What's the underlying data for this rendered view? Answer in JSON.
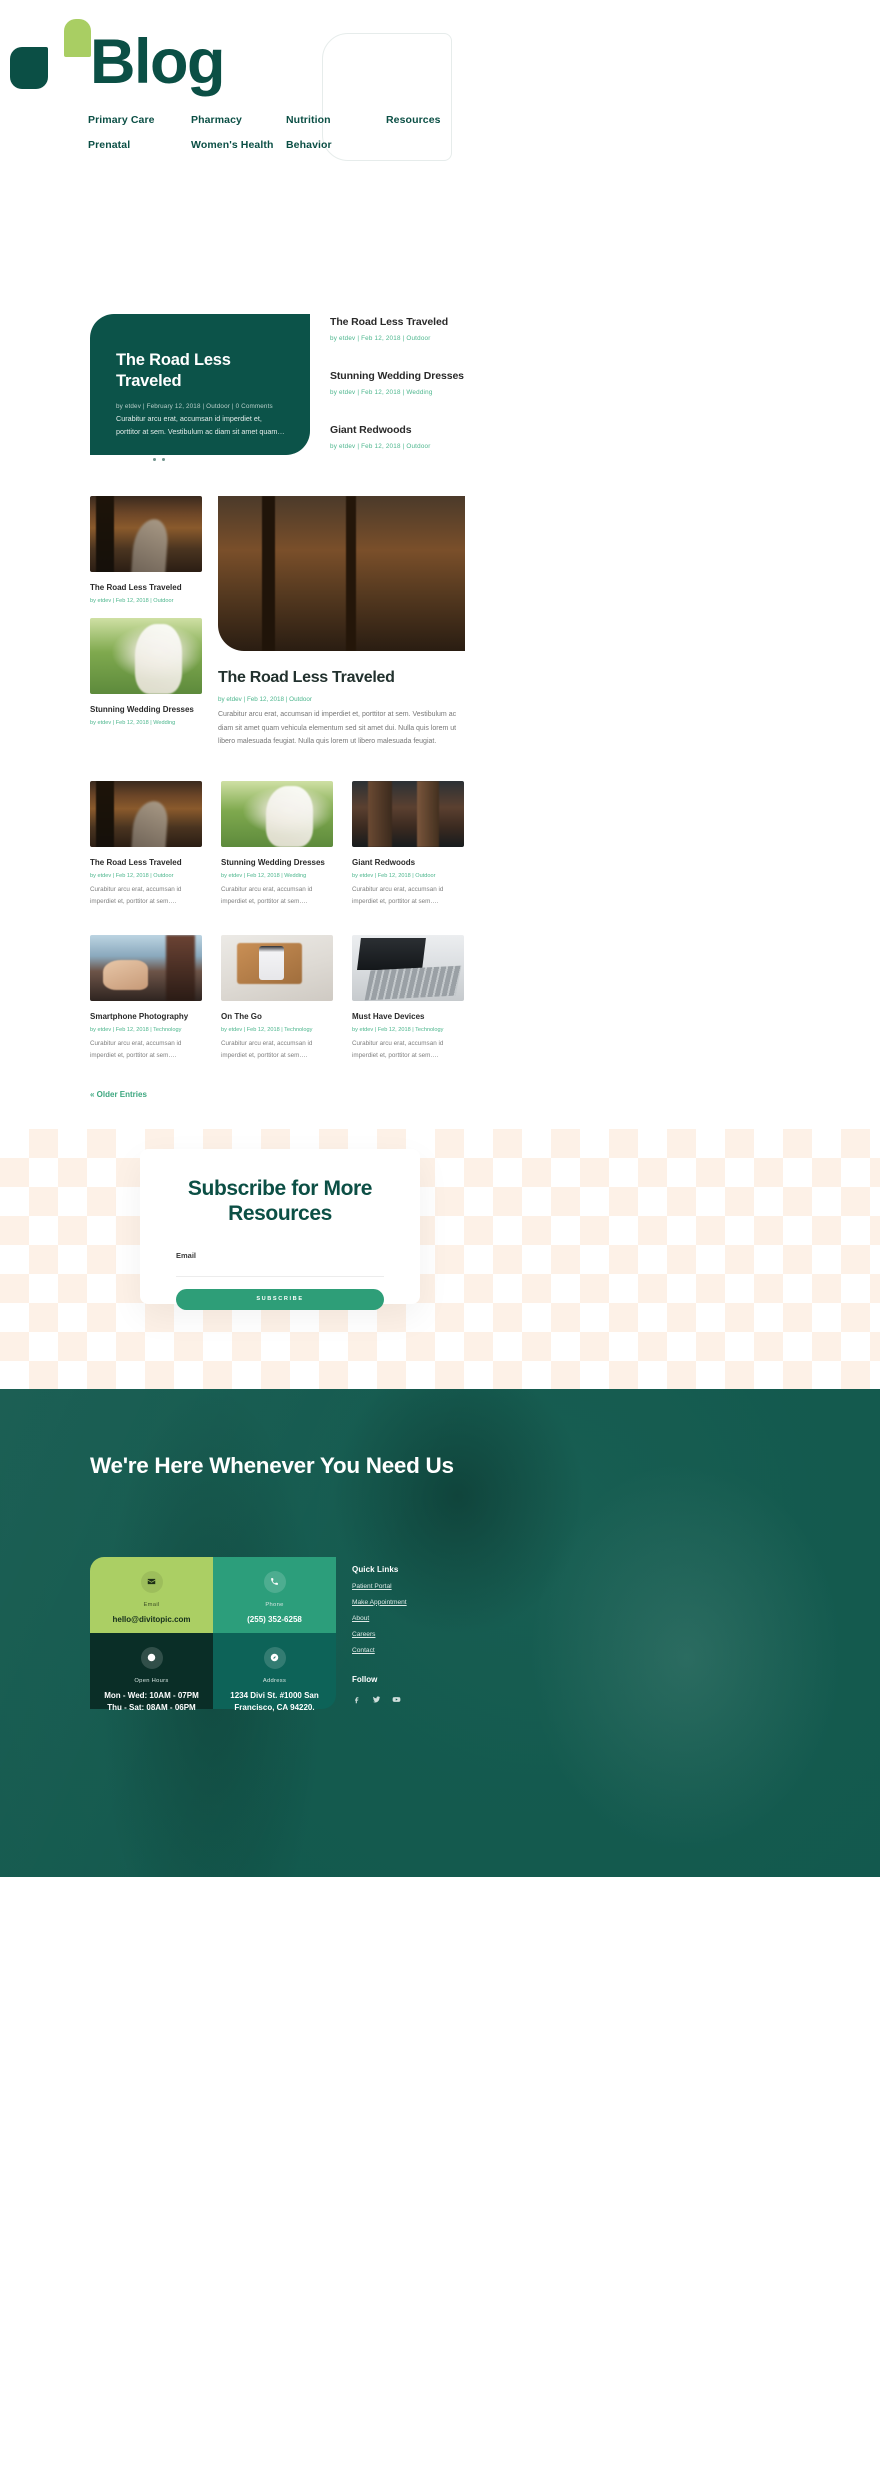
{
  "brand": {
    "title": "Blog",
    "logo_icon": "leaf-logo-icon"
  },
  "nav": {
    "panel_label": "Resources",
    "row1": [
      "Primary Care",
      "Pharmacy",
      "Nutrition"
    ],
    "row2": [
      "Prenatal",
      "Women's Health",
      "Behavior"
    ]
  },
  "featured": {
    "title": "The Road Less Traveled",
    "meta": "by etdev | February 12, 2018 | Outdoor | 0 Comments",
    "excerpt": "Curabitur arcu erat, accumsan id imperdiet et, porttitor at sem. Vestibulum ac diam sit amet quam…",
    "slides": 3,
    "active_slide": 1
  },
  "side_posts": [
    {
      "title": "The Road Less Traveled",
      "meta": "by etdev | Feb 12, 2018 | Outdoor"
    },
    {
      "title": "Stunning Wedding Dresses",
      "meta": "by etdev | Feb 12, 2018 | Wedding"
    },
    {
      "title": "Giant Redwoods",
      "meta": "by etdev | Feb 12, 2018 | Outdoor"
    }
  ],
  "left_posts": [
    {
      "title": "The Road Less Traveled",
      "meta": "by etdev | Feb 12, 2018 | Outdoor",
      "image": "autumn-road-photo"
    },
    {
      "title": "Stunning Wedding Dresses",
      "meta": "by etdev | Feb 12, 2018 | Wedding",
      "image": "bride-in-field-photo"
    }
  ],
  "main_post": {
    "title": "The Road Less Traveled",
    "meta": "by etdev | Feb 12, 2018 | Outdoor",
    "excerpt": "Curabitur arcu erat, accumsan id imperdiet et, porttitor at sem. Vestibulum ac diam sit amet quam vehicula elementum sed sit amet dui. Nulla quis lorem ut libero malesuada feugiat. Nulla quis lorem ut libero malesuada feugiat.",
    "image": "autumn-forest-photo"
  },
  "grid_posts": [
    {
      "title": "The Road Less Traveled",
      "meta": "by etdev | Feb 12, 2018 | Outdoor",
      "excerpt": "Curabitur arcu erat, accumsan id imperdiet et, porttitor at sem….",
      "image": "autumn-road-photo"
    },
    {
      "title": "Stunning Wedding Dresses",
      "meta": "by etdev | Feb 12, 2018 | Wedding",
      "excerpt": "Curabitur arcu erat, accumsan id imperdiet et, porttitor at sem….",
      "image": "bride-in-field-photo"
    },
    {
      "title": "Giant Redwoods",
      "meta": "by etdev | Feb 12, 2018 | Outdoor",
      "excerpt": "Curabitur arcu erat, accumsan id imperdiet et, porttitor at sem….",
      "image": "redwood-trees-photo"
    },
    {
      "title": "Smartphone Photography",
      "meta": "by etdev | Feb 12, 2018 | Technology",
      "excerpt": "Curabitur arcu erat, accumsan id imperdiet et, porttitor at sem….",
      "image": "hands-holding-phone-photo"
    },
    {
      "title": "On The Go",
      "meta": "by etdev | Feb 12, 2018 | Technology",
      "excerpt": "Curabitur arcu erat, accumsan id imperdiet et, porttitor at sem….",
      "image": "phone-stylus-desk-photo"
    },
    {
      "title": "Must Have Devices",
      "meta": "by etdev | Feb 12, 2018 | Technology",
      "excerpt": "Curabitur arcu erat, accumsan id imperdiet et, porttitor at sem….",
      "image": "laptop-keyboard-photo"
    }
  ],
  "pagination": {
    "older_entries": "« Older Entries"
  },
  "subscribe": {
    "heading": "Subscribe for More Resources",
    "email_label": "Email",
    "email_value": "",
    "email_placeholder": "",
    "button_label": "SUBSCRIBE",
    "button_color": "#2e9e78"
  },
  "footer": {
    "heading": "We're Here Whenever You Need Us",
    "contact_cards": [
      {
        "icon": "envelope-icon",
        "label": "Email",
        "value": "hello@divitopic.com",
        "color": "#abcf64"
      },
      {
        "icon": "phone-icon",
        "label": "Phone",
        "value": "(255) 352-6258",
        "color": "#2c9e7b"
      },
      {
        "icon": "clock-icon",
        "label": "Open Hours",
        "value": "Mon - Wed: 10AM - 07PM\nThu - Sat: 08AM - 06PM",
        "color": "#0a2e27"
      },
      {
        "icon": "compass-icon",
        "label": "Address",
        "value": "1234 Divi St. #1000 San Francisco, CA 94220.",
        "color": "#0d6358"
      }
    ],
    "quick_links_heading": "Quick Links",
    "quick_links": [
      "Patient Portal",
      "Make Appointment",
      "About",
      "Careers",
      "Contact"
    ],
    "follow_heading": "Follow",
    "socials": [
      "facebook-icon",
      "twitter-icon",
      "youtube-icon"
    ]
  }
}
